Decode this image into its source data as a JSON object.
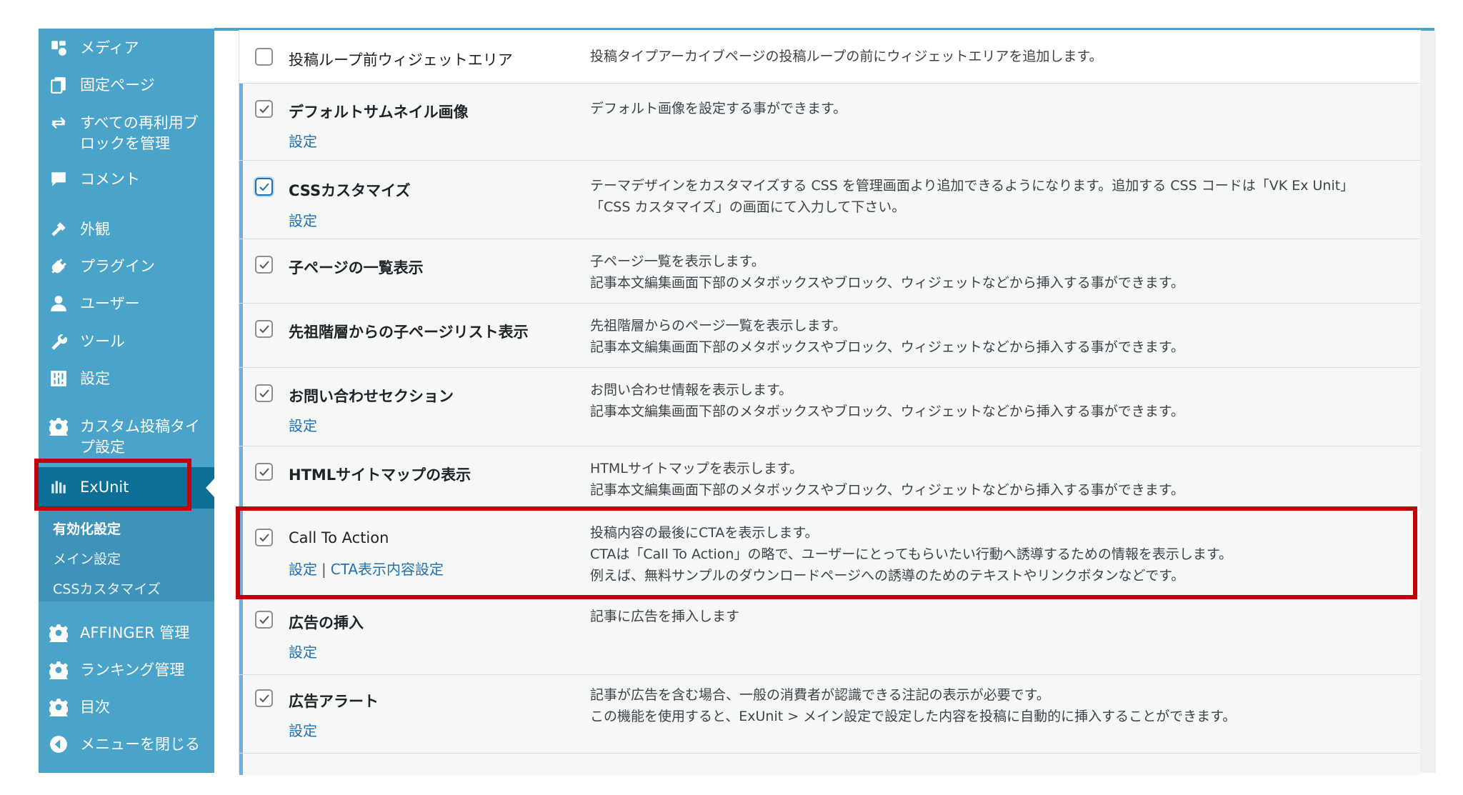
{
  "sidebar": {
    "items": [
      {
        "label": "メディア",
        "icon": "media-icon"
      },
      {
        "label": "固定ページ",
        "icon": "pages-icon"
      },
      {
        "label": "すべての再利用ブロックを管理",
        "icon": "reusable-blocks-icon"
      },
      {
        "label": "コメント",
        "icon": "comments-icon"
      },
      {
        "label": "外観",
        "icon": "appearance-icon"
      },
      {
        "label": "プラグイン",
        "icon": "plugins-icon"
      },
      {
        "label": "ユーザー",
        "icon": "users-icon"
      },
      {
        "label": "ツール",
        "icon": "tools-icon"
      },
      {
        "label": "設定",
        "icon": "settings-icon"
      },
      {
        "label": "カスタム投稿タイプ設定",
        "icon": "gear-icon"
      }
    ],
    "exunit": {
      "label": "ExUnit",
      "icon": "exunit-icon"
    },
    "submenu": [
      "有効化設定",
      "メイン設定",
      "CSSカスタマイズ"
    ],
    "bottom_items": [
      {
        "label": "AFFINGER 管理",
        "icon": "gear-icon"
      },
      {
        "label": "ランキング管理",
        "icon": "gear-icon"
      },
      {
        "label": "目次",
        "icon": "gear-icon"
      },
      {
        "label": "メニューを閉じる",
        "icon": "collapse-icon"
      }
    ]
  },
  "modules": [
    {
      "name": "投稿ループ前ウィジェットエリア",
      "checked": false,
      "links": [],
      "desc": [
        "投稿タイプアーカイブページの投稿ループの前にウィジェットエリアを追加します。"
      ]
    },
    {
      "name": "デフォルトサムネイル画像",
      "checked": true,
      "links": [
        "設定"
      ],
      "desc": [
        "デフォルト画像を設定する事ができます。"
      ]
    },
    {
      "name": "CSSカスタマイズ",
      "checked": true,
      "links": [
        "設定"
      ],
      "desc": [
        "テーマデザインをカスタマイズする CSS を管理画面より追加できるようになります。追加する CSS コードは「VK Ex Unit」",
        "「CSS カスタマイズ」の画面にて入力して下さい。"
      ]
    },
    {
      "name": "子ページの一覧表示",
      "checked": true,
      "links": [],
      "desc": [
        "子ページ一覧を表示します。",
        "記事本文編集画面下部のメタボックスやブロック、ウィジェットなどから挿入する事ができます。"
      ]
    },
    {
      "name": "先祖階層からの子ページリスト表示",
      "checked": true,
      "links": [],
      "desc": [
        "先祖階層からのページ一覧を表示します。",
        "記事本文編集画面下部のメタボックスやブロック、ウィジェットなどから挿入する事ができます。"
      ]
    },
    {
      "name": "お問い合わせセクション",
      "checked": true,
      "links": [
        "設定"
      ],
      "desc": [
        "お問い合わせ情報を表示します。",
        "記事本文編集画面下部のメタボックスやブロック、ウィジェットなどから挿入する事ができます。"
      ]
    },
    {
      "name": "HTMLサイトマップの表示",
      "checked": true,
      "links": [],
      "desc": [
        "HTMLサイトマップを表示します。",
        "記事本文編集画面下部のメタボックスやブロック、ウィジェットなどから挿入する事ができます。"
      ]
    },
    {
      "name": "Call To Action",
      "checked": true,
      "links": [
        "設定",
        "CTA表示内容設定"
      ],
      "link_separator": "|",
      "desc": [
        "投稿内容の最後にCTAを表示します。",
        "CTAは「Call To Action」の略で、ユーザーにとってもらいたい行動へ誘導するための情報を表示します。",
        "例えば、無料サンプルのダウンロードページへの誘導のためのテキストやリンクボタンなどです。"
      ]
    },
    {
      "name": "広告の挿入",
      "checked": true,
      "links": [
        "設定"
      ],
      "desc": [
        "記事に広告を挿入します"
      ]
    },
    {
      "name": "広告アラート",
      "checked": true,
      "links": [
        "設定"
      ],
      "desc": [
        "記事が広告を含む場合、一般の消費者が認識できる注記の表示が必要です。",
        "この機能を使用すると、ExUnit > メイン設定で設定した内容を投稿に自動的に挿入することができます。"
      ]
    }
  ],
  "colors": {
    "sidebar": "#4aa3c8",
    "sidebar_active": "#0d6f96",
    "link": "#2271b1",
    "highlight": "#c0000b"
  }
}
